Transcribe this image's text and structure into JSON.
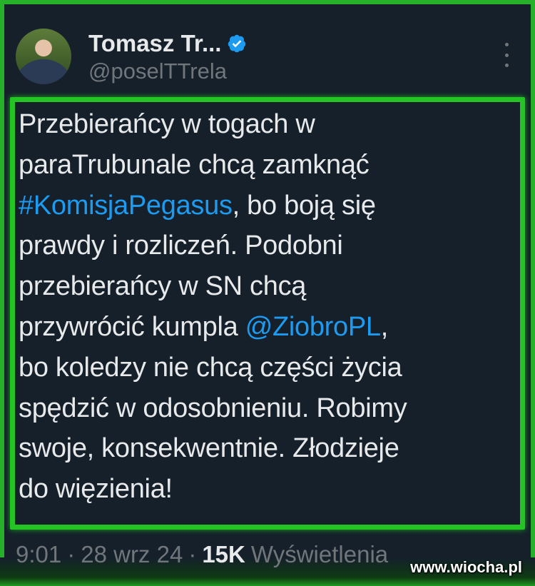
{
  "author": {
    "display_name": "Tomasz Tr...",
    "handle": "@poselTTrela",
    "verified_icon": "verified-badge-icon",
    "avatar": "profile-photo"
  },
  "tweet": {
    "lines": [
      [
        {
          "text": "Przebierańcy w togach w"
        }
      ],
      [
        {
          "text": "paraTrubunale chcą zamknąć"
        }
      ],
      [
        {
          "text": "#KomisjaPegasus",
          "link": true
        },
        {
          "text": ", bo boją się"
        }
      ],
      [
        {
          "text": "prawdy i rozliczeń. Podobni"
        }
      ],
      [
        {
          "text": "przebierańcy w SN chcą"
        }
      ],
      [
        {
          "text": "przywrócić kumpla "
        },
        {
          "text": "@ZiobroPL",
          "link": true
        },
        {
          "text": ","
        }
      ],
      [
        {
          "text": "bo koledzy nie chcą części życia"
        }
      ],
      [
        {
          "text": "spędzić w odosobnieniu. Robimy"
        }
      ],
      [
        {
          "text": "swoje, konsekwentnie. Złodzieje"
        }
      ],
      [
        {
          "text": "do więzienia!"
        }
      ]
    ]
  },
  "meta": {
    "time": "9:01",
    "sep1": "·",
    "date": "28 wrz 24",
    "sep2": "·",
    "views_count": "15K",
    "views_label": "Wyświetlenia"
  },
  "watermark": "www.wiocha.pl",
  "colors": {
    "background": "#15202b",
    "frame_green": "#24c424",
    "link_blue": "#1d9bf0",
    "verified_blue": "#1d9bf0"
  }
}
